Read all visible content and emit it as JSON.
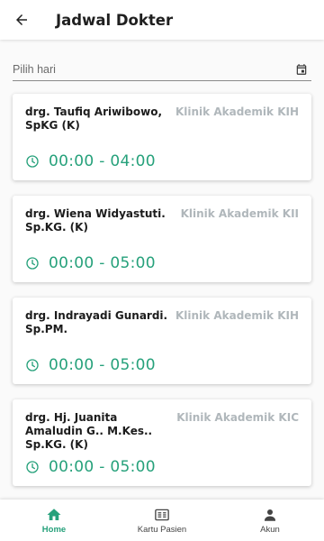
{
  "header": {
    "title": "Jadwal Dokter",
    "back_icon": "arrow-left-icon"
  },
  "date_field": {
    "placeholder": "Pilih hari",
    "icon": "calendar-icon"
  },
  "schedules": [
    {
      "doctor": "drg. Taufiq Ariwibowo, SpKG (K)",
      "clinic": "Klinik Akademik KIH",
      "time": "00:00 - 04:00"
    },
    {
      "doctor": "drg. Wiena Widyastuti. Sp.KG. (K)",
      "clinic": "Klinik Akademik KII",
      "time": "00:00 - 05:00"
    },
    {
      "doctor": "drg. Indrayadi Gunardi. Sp.PM.",
      "clinic": "Klinik Akademik KIH",
      "time": "00:00 - 05:00"
    },
    {
      "doctor": "drg. Hj. Juanita Amaludin G.. M.Kes.. Sp.KG. (K)",
      "clinic": "Klinik Akademik KIC",
      "time": "00:00 - 05:00"
    }
  ],
  "bottom_nav": [
    {
      "label": "Home",
      "icon": "home-icon",
      "active": true
    },
    {
      "label": "Kartu Pasien",
      "icon": "card-icon",
      "active": false
    },
    {
      "label": "Akun",
      "icon": "person-icon",
      "active": false
    }
  ],
  "colors": {
    "accent": "#26a17b",
    "clinic_text": "#b0b7bb"
  }
}
